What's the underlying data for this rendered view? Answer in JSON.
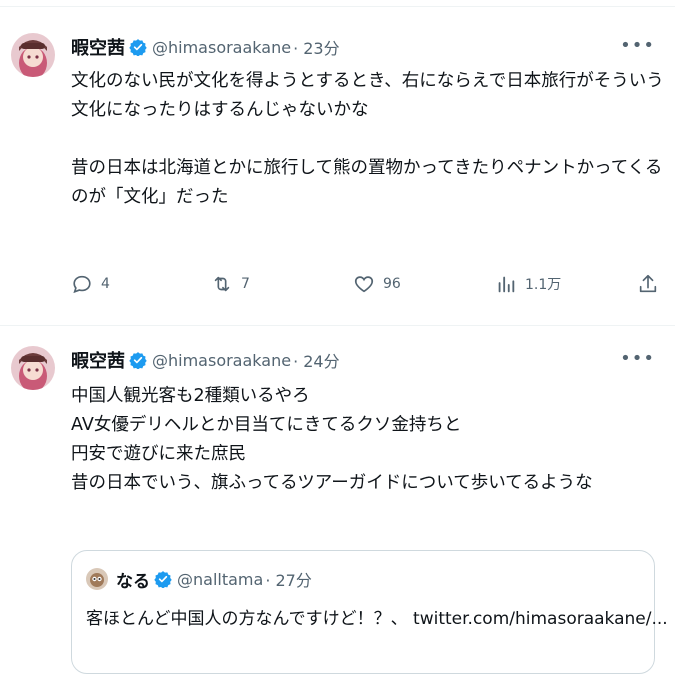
{
  "colors": {
    "accent": "#1d9bf0",
    "text": "#0f1419",
    "muted": "#536471",
    "border": "#cfd9de"
  },
  "tweets": [
    {
      "name": "暇空茜",
      "handle": "@himasoraakane",
      "time": "· 23分",
      "lines": [
        "文化のない民が文化を得ようとするとき、右にならえで日本旅行がそういう",
        "文化になったりはするんじゃないかな",
        "",
        "昔の日本は北海道とかに旅行して熊の置物かってきたりペナントかってくる",
        "のが「文化」だった"
      ],
      "actions": {
        "reply": "4",
        "retweet": "7",
        "like": "96",
        "views": "1.1万"
      }
    },
    {
      "name": "暇空茜",
      "handle": "@himasoraakane",
      "time": "· 24分",
      "lines": [
        "中国人観光客も2種類いるやろ",
        "AV女優デリヘルとか目当てにきてるクソ金持ちと",
        "円安で遊びに来た庶民",
        "昔の日本でいう、旗ふってるツアーガイドについて歩いてるような"
      ],
      "quote": {
        "name": "なる",
        "handle": "@nalltama",
        "time": "· 27分",
        "text": "客ほとんど中国人の方なんですけど！？、 twitter.com/himasoraakane/..."
      }
    }
  ]
}
